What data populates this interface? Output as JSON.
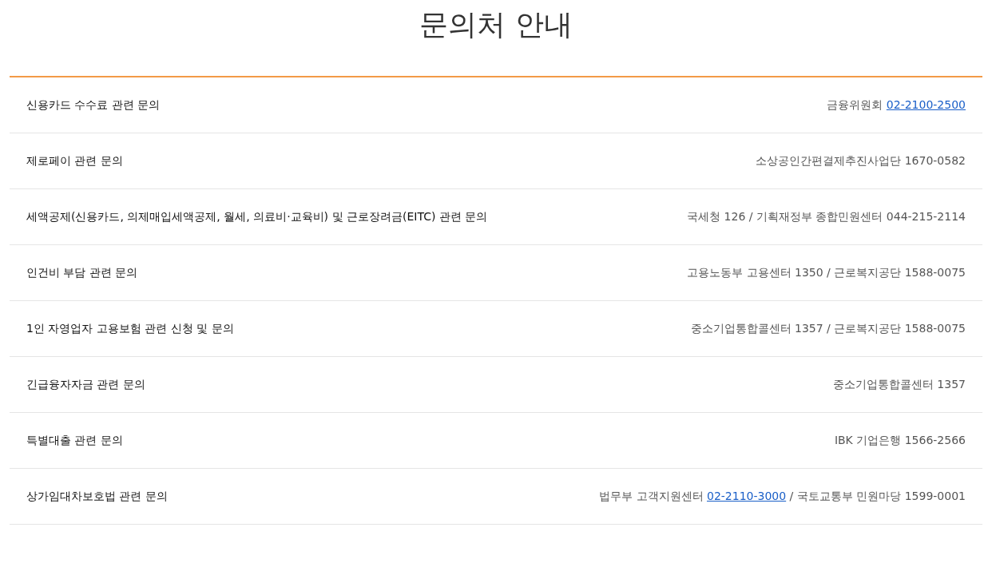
{
  "title": "문의처 안내",
  "rows": [
    {
      "topic": "신용카드 수수료 관련 문의",
      "contact": [
        {
          "kind": "text",
          "text": "금융위원회 "
        },
        {
          "kind": "link",
          "text": "02-2100-2500"
        }
      ]
    },
    {
      "topic": "제로페이 관련 문의",
      "contact": [
        {
          "kind": "text",
          "text": "소상공인간편결제추진사업단 1670-0582"
        }
      ]
    },
    {
      "topic": "세액공제(신용카드, 의제매입세액공제, 월세, 의료비·교육비) 및 근로장려금(EITC) 관련 문의",
      "contact": [
        {
          "kind": "text",
          "text": "국세청 126 / 기획재정부 종합민원센터 044-215-2114"
        }
      ]
    },
    {
      "topic": "인건비 부담 관련 문의",
      "contact": [
        {
          "kind": "text",
          "text": "고용노동부 고용센터 1350 / 근로복지공단 1588-0075"
        }
      ]
    },
    {
      "topic": "1인 자영업자 고용보험 관련 신청 및 문의",
      "contact": [
        {
          "kind": "text",
          "text": "중소기업통합콜센터 1357 / 근로복지공단 1588-0075"
        }
      ]
    },
    {
      "topic": "긴급융자자금 관련 문의",
      "contact": [
        {
          "kind": "text",
          "text": "중소기업통합콜센터 1357"
        }
      ]
    },
    {
      "topic": "특별대출 관련 문의",
      "contact": [
        {
          "kind": "text",
          "text": "IBK 기업은행 1566-2566"
        }
      ]
    },
    {
      "topic": "상가임대차보호법 관련 문의",
      "contact": [
        {
          "kind": "text",
          "text": "법무부 고객지원센터 "
        },
        {
          "kind": "link",
          "text": "02-2110-3000"
        },
        {
          "kind": "text",
          "text": " / 국토교통부 민원마당 1599-0001"
        }
      ]
    }
  ]
}
